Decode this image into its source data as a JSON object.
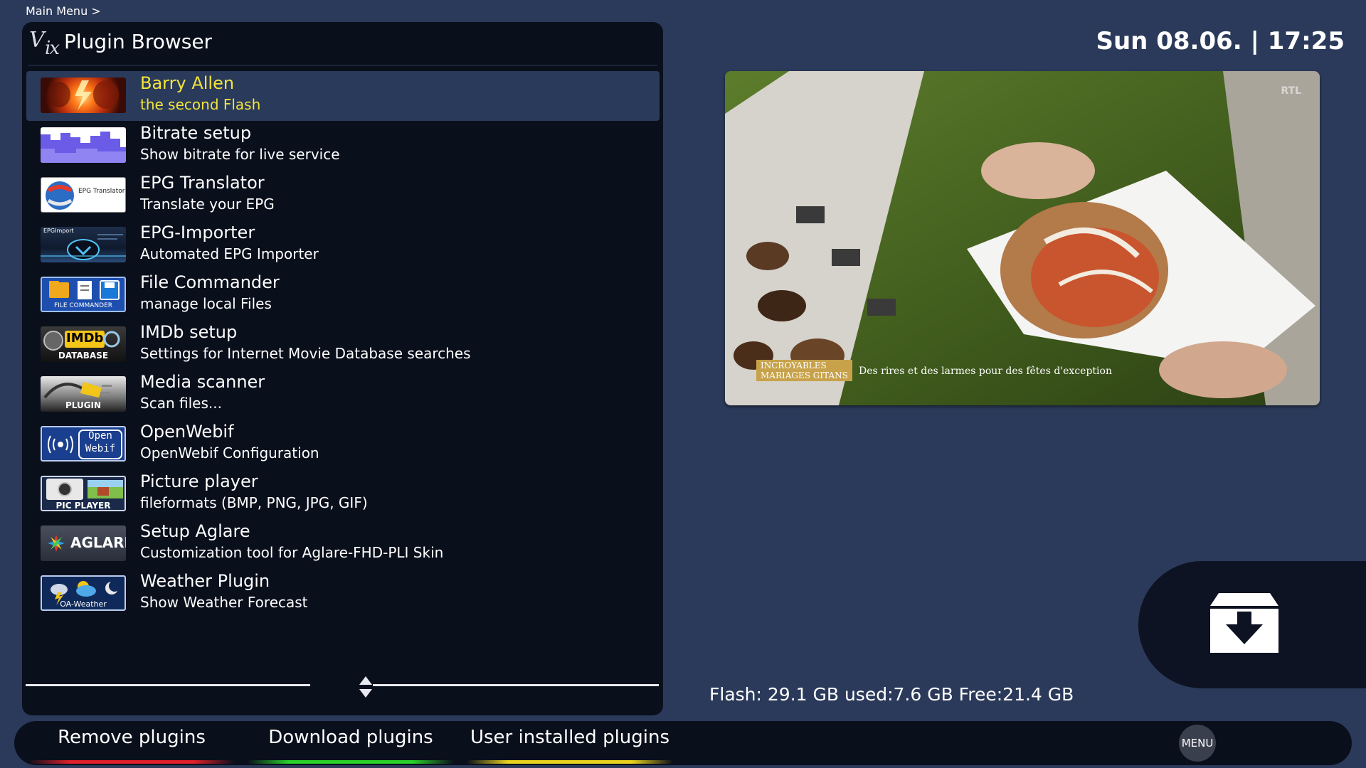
{
  "breadcrumb": "Main Menu >",
  "header": {
    "title": "Plugin Browser"
  },
  "clock": {
    "text": "Sun 08.06.  |  17:25"
  },
  "plugins": [
    {
      "title": "Barry Allen",
      "subtitle": "the second Flash",
      "icon": "flash-hero-icon",
      "selected": true
    },
    {
      "title": "Bitrate setup",
      "subtitle": "Show bitrate for live service",
      "icon": "bitrate-icon"
    },
    {
      "title": "EPG Translator",
      "subtitle": "Translate your EPG",
      "icon": "epg-translator-icon"
    },
    {
      "title": "EPG-Importer",
      "subtitle": "Automated EPG Importer",
      "icon": "epg-importer-icon"
    },
    {
      "title": "File Commander",
      "subtitle": "manage local Files",
      "icon": "file-commander-icon"
    },
    {
      "title": "IMDb setup",
      "subtitle": "Settings for Internet Movie Database searches",
      "icon": "imdb-icon"
    },
    {
      "title": "Media scanner",
      "subtitle": "Scan files...",
      "icon": "plugin-plug-icon"
    },
    {
      "title": "OpenWebif",
      "subtitle": "OpenWebif Configuration",
      "icon": "openwebif-icon"
    },
    {
      "title": "Picture player",
      "subtitle": "fileformats (BMP, PNG, JPG, GIF)",
      "icon": "picture-player-icon"
    },
    {
      "title": "Setup Aglare",
      "subtitle": "Customization tool for Aglare-FHD-PLI Skin",
      "icon": "aglare-icon"
    },
    {
      "title": "Weather Plugin",
      "subtitle": "Show Weather Forecast",
      "icon": "weather-icon"
    }
  ],
  "thumb_text": {
    "epg_translator": "EPG Translator",
    "epg_importer": "EPGImport",
    "file_commander": "FILE COMMANDER",
    "imdb_top": "IMDb",
    "imdb_bottom": "DATABASE",
    "media_scanner": "PLUGIN",
    "openwebif_top": "Open",
    "openwebif_bottom": "Webif",
    "pic_player": "PIC PLAYER",
    "aglare": "AGLARE",
    "weather": "OA-Weather"
  },
  "tv": {
    "show_title_line1": "INCROYABLES",
    "show_title_line2": "MARIAGES GITANS",
    "caption": "Des rires et des larmes pour des fêtes d'exception",
    "channel_logo": "RTL"
  },
  "flash_info": "Flash: 29.1 GB used:7.6 GB Free:21.4 GB",
  "bottom_buttons": [
    {
      "label": "Remove plugins",
      "color": "#e0202a"
    },
    {
      "label": "Download plugins",
      "color": "#2bd12b"
    },
    {
      "label": "User installed plugins",
      "color": "#e8d21e"
    }
  ],
  "menu_button": "MENU",
  "colors": {
    "background": "#2b3a5a",
    "panel": "#0a0f1c",
    "selection": "#2a3a5a",
    "highlight_text": "#f2e43b"
  }
}
